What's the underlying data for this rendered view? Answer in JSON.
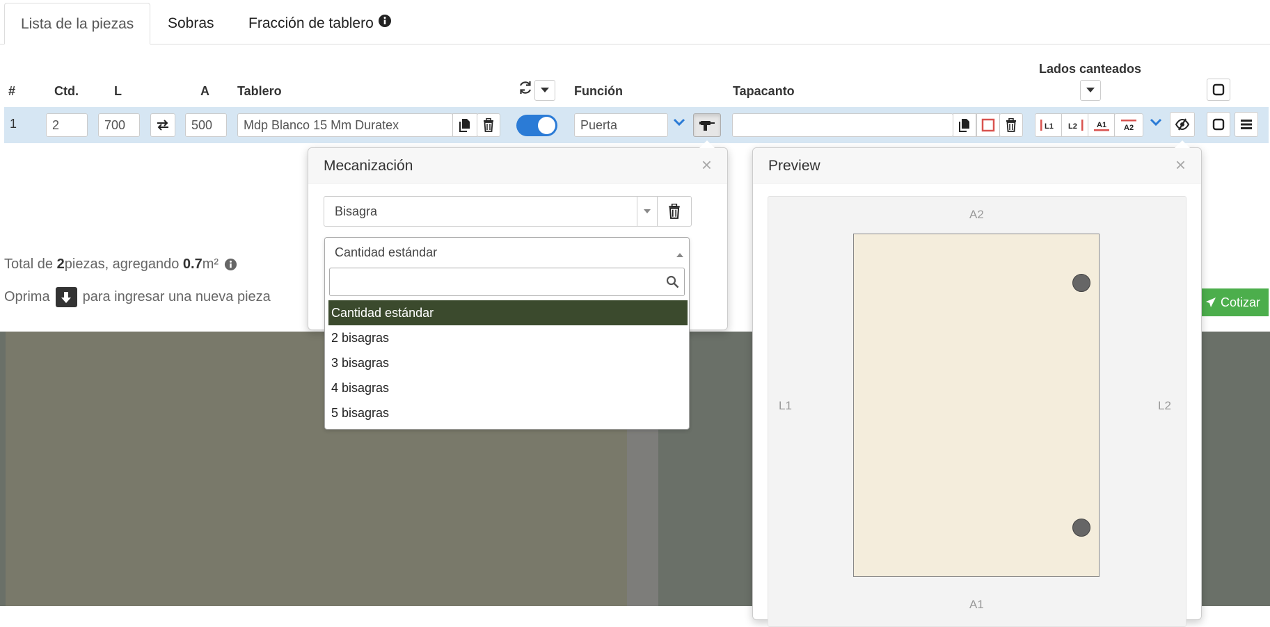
{
  "tabs": [
    {
      "label": "Lista de la piezas"
    },
    {
      "label": "Sobras"
    },
    {
      "label": "Fracción de tablero"
    }
  ],
  "headers": {
    "num": "#",
    "qty": "Ctd.",
    "l": "L",
    "a": "A",
    "board": "Tablero",
    "function": "Función",
    "edge": "Tapacanto",
    "edged_sides": "Lados canteados"
  },
  "row": {
    "index": "1",
    "qty": "2",
    "length": "700",
    "width": "500",
    "board": "Mdp Blanco 15 Mm Duratex",
    "function": "Puerta",
    "edge": "",
    "rotate_enabled": true,
    "edge_side_buttons": [
      "L1",
      "L2",
      "A1",
      "A2"
    ]
  },
  "summary": {
    "prefix": "Total de ",
    "count": "2",
    "middle": " piezas, agregando ",
    "area": "0.7",
    "unit": " m²",
    "hint_prefix": "Oprima",
    "hint_suffix": "para ingresar una nueva pieza"
  },
  "quote_button": "Cotizar",
  "mecanizacion": {
    "title": "Mecanización",
    "type_value": "Bisagra",
    "qty_value": "Cantidad estándar",
    "search_placeholder": "",
    "options": [
      "Cantidad estándar",
      "2 bisagras",
      "3 bisagras",
      "4 bisagras",
      "5 bisagras"
    ]
  },
  "preview": {
    "title": "Preview",
    "labels": {
      "top": "A2",
      "bottom": "A1",
      "left": "L1",
      "right": "L2"
    },
    "hinge_count": 2
  },
  "colors": {
    "accent_blue": "#2b7bd6",
    "row_bg": "#d6e6f3",
    "option_selected": "#3b4a2d",
    "piece_fill": "#f4eddc",
    "quote_green": "#4cae4c",
    "edge_red": "#d9534f"
  }
}
